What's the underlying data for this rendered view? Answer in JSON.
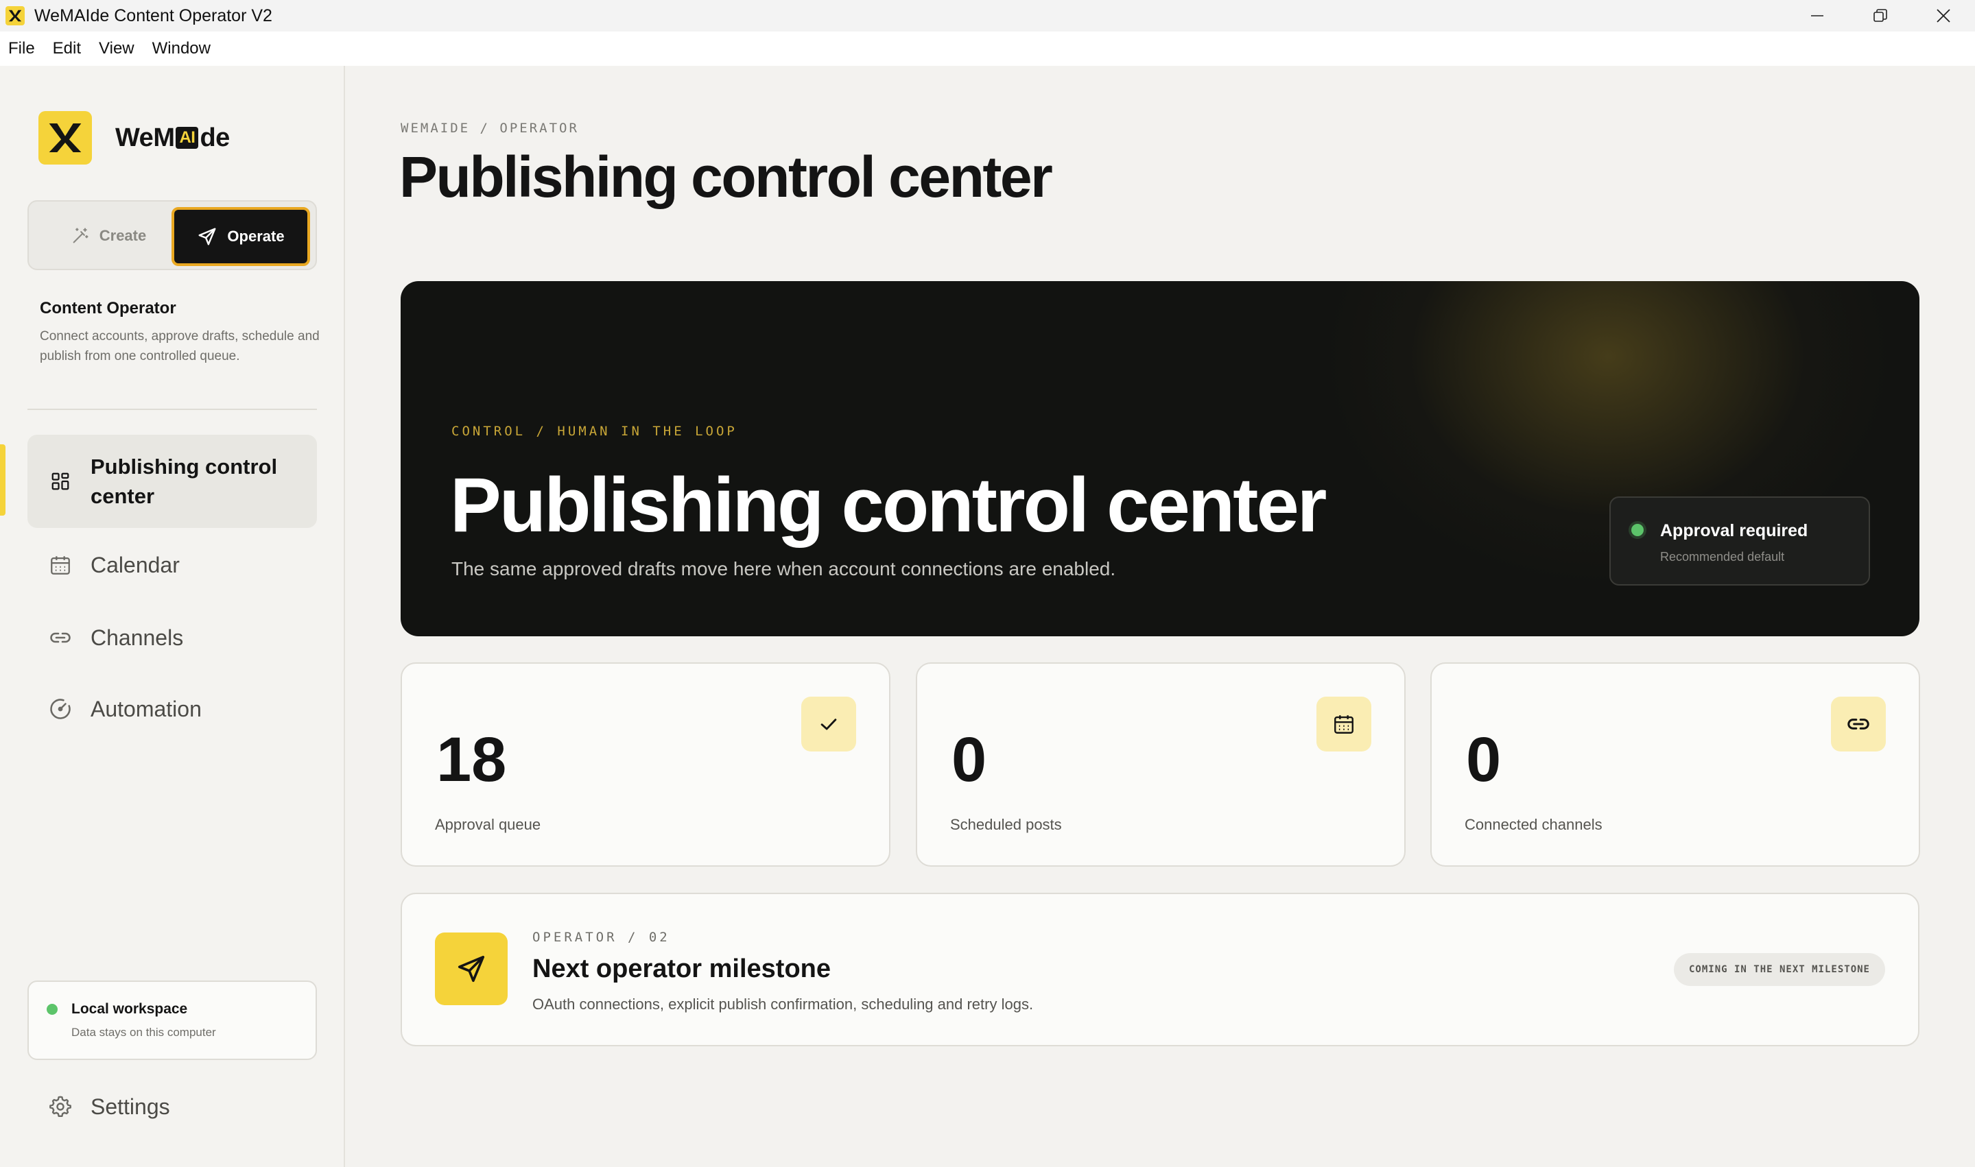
{
  "window": {
    "title": "WeMAIde Content Operator V2"
  },
  "menu": [
    "File",
    "Edit",
    "View",
    "Window"
  ],
  "brand": {
    "prefix": "WeM",
    "ai": "AI",
    "suffix": "de"
  },
  "mode_switch": {
    "create_label": "Create",
    "operate_label": "Operate",
    "active": "Operate"
  },
  "sidebar": {
    "section_title": "Content Operator",
    "section_desc": "Connect accounts, approve drafts, schedule and publish from one controlled queue.",
    "nav": [
      {
        "label": "Publishing control center",
        "icon": "dashboard-icon",
        "active": true
      },
      {
        "label": "Calendar",
        "icon": "calendar-icon",
        "active": false
      },
      {
        "label": "Channels",
        "icon": "link-icon",
        "active": false
      },
      {
        "label": "Automation",
        "icon": "gauge-icon",
        "active": false
      }
    ],
    "workspace": {
      "title": "Local workspace",
      "subtitle": "Data stays on this computer"
    },
    "settings_label": "Settings"
  },
  "main": {
    "breadcrumb": "WEMAIDE / OPERATOR",
    "title": "Publishing control center",
    "hero": {
      "kicker": "CONTROL / HUMAN IN THE LOOP",
      "title": "Publishing control center",
      "subtitle": "The same approved drafts move here when account connections are enabled.",
      "approval": {
        "title": "Approval required",
        "subtitle": "Recommended default"
      }
    },
    "stats": [
      {
        "value": "18",
        "label": "Approval queue",
        "icon": "check-icon"
      },
      {
        "value": "0",
        "label": "Scheduled posts",
        "icon": "calendar-icon"
      },
      {
        "value": "0",
        "label": "Connected channels",
        "icon": "link-icon"
      }
    ],
    "milestone": {
      "kicker": "OPERATOR / 02",
      "title": "Next operator milestone",
      "desc": "OAuth connections, explicit publish confirmation, scheduling and retry logs.",
      "badge": "COMING IN THE NEXT MILESTONE"
    }
  },
  "colors": {
    "accent": "#f5d33a",
    "accent_border": "#e9a821",
    "status_ok": "#5cc46a",
    "hero_bg": "#121311"
  }
}
